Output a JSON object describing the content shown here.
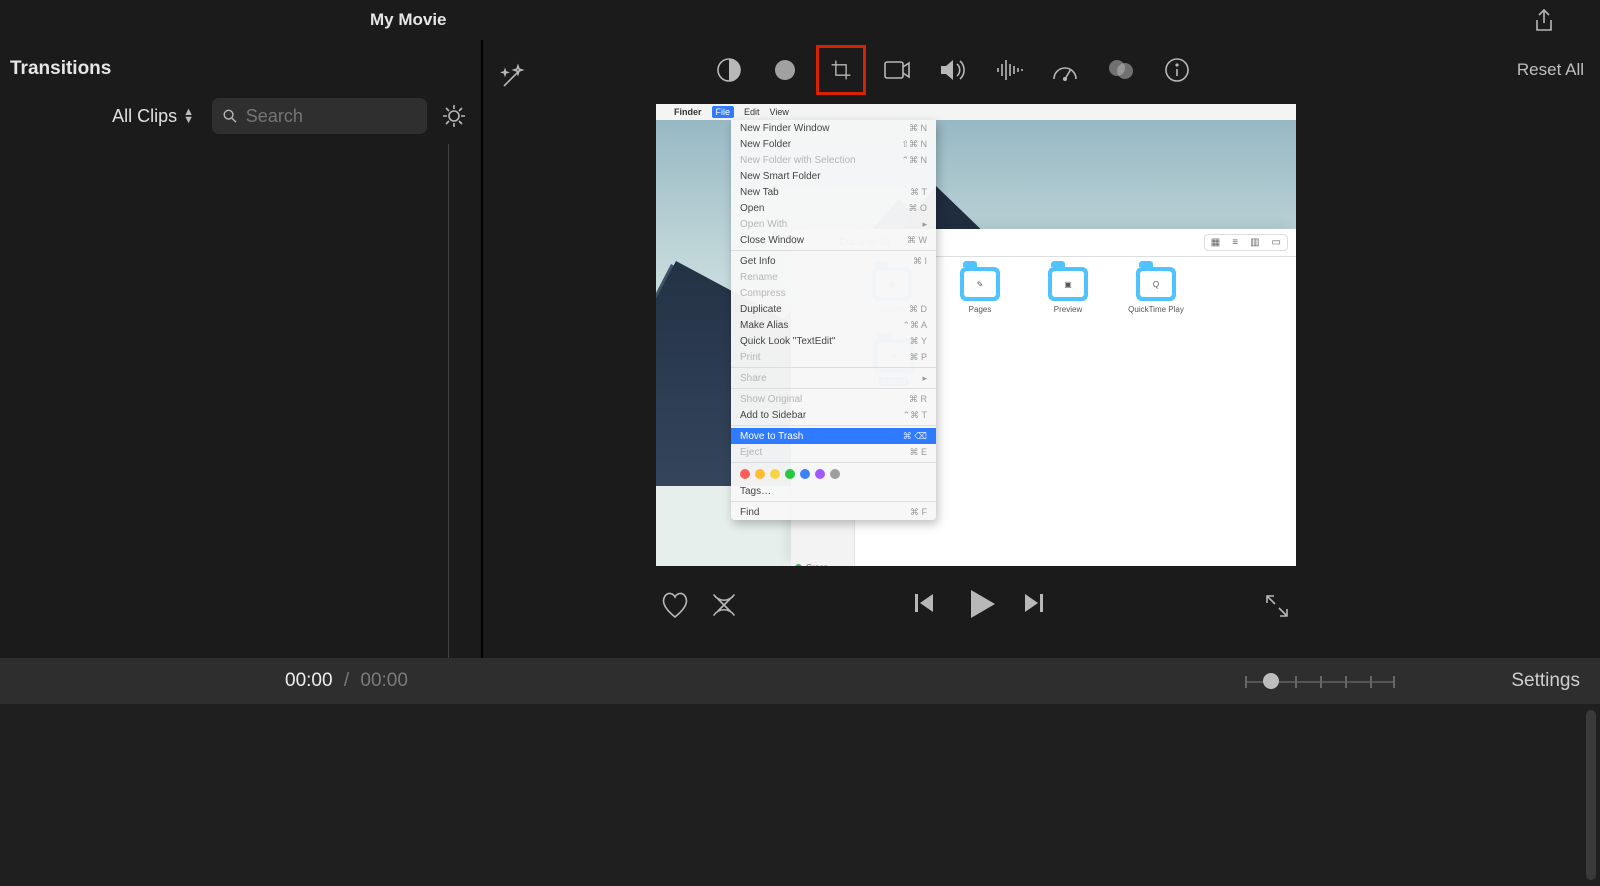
{
  "title": "My Movie",
  "sidebar_tab": "Transitions",
  "filter": {
    "label": "All Clips"
  },
  "search": {
    "placeholder": "Search"
  },
  "reset_label": "Reset All",
  "tooltip": "Cropping",
  "time": {
    "current": "00:00",
    "total": "00:00"
  },
  "settings_label": "Settings",
  "mac_menubar": [
    "Finder",
    "File",
    "Edit",
    "View"
  ],
  "ctx": {
    "items": [
      {
        "label": "New Finder Window",
        "sc": "⌘ N",
        "dis": false
      },
      {
        "label": "New Folder",
        "sc": "⇧⌘ N",
        "dis": false
      },
      {
        "label": "New Folder with Selection",
        "sc": "⌃⌘ N",
        "dis": true
      },
      {
        "label": "New Smart Folder",
        "sc": "",
        "dis": false
      },
      {
        "label": "New Tab",
        "sc": "⌘ T",
        "dis": false
      },
      {
        "label": "Open",
        "sc": "⌘ O",
        "dis": false
      },
      {
        "label": "Open With",
        "sc": "▸",
        "dis": true
      },
      {
        "label": "Close Window",
        "sc": "⌘ W",
        "dis": false
      }
    ],
    "items2": [
      {
        "label": "Get Info",
        "sc": "⌘ I",
        "dis": false
      },
      {
        "label": "Rename",
        "sc": "",
        "dis": true
      },
      {
        "label": "Compress",
        "sc": "",
        "dis": true
      },
      {
        "label": "Duplicate",
        "sc": "⌘ D",
        "dis": false
      },
      {
        "label": "Make Alias",
        "sc": "⌃⌘ A",
        "dis": false
      },
      {
        "label": "Quick Look \"TextEdit\"",
        "sc": "⌘ Y",
        "dis": false
      },
      {
        "label": "Print",
        "sc": "⌘ P",
        "dis": true
      }
    ],
    "items3": [
      {
        "label": "Share",
        "sc": "▸",
        "dis": true
      }
    ],
    "items4": [
      {
        "label": "Show Original",
        "sc": "⌘ R",
        "dis": true
      },
      {
        "label": "Add to Sidebar",
        "sc": "⌃⌘ T",
        "dis": false
      }
    ],
    "items5": [
      {
        "label": "Move to Trash",
        "sc": "⌘ ⌫",
        "dis": false,
        "hl": true
      },
      {
        "label": "Eject",
        "sc": "⌘ E",
        "dis": true
      }
    ],
    "tags_label": "Tags…",
    "find": {
      "label": "Find",
      "sc": "⌘ F"
    }
  },
  "finder": {
    "location": "Documents",
    "apps": [
      "eynote",
      "Pages",
      "Preview",
      "QuickTime Play"
    ],
    "selected": "extEdit",
    "sidebar_tag": "Green"
  },
  "tag_colors": [
    "#ff5f57",
    "#febc2e",
    "#f9d24a",
    "#28c840",
    "#3b82f6",
    "#a259ff",
    "#9e9e9e"
  ]
}
